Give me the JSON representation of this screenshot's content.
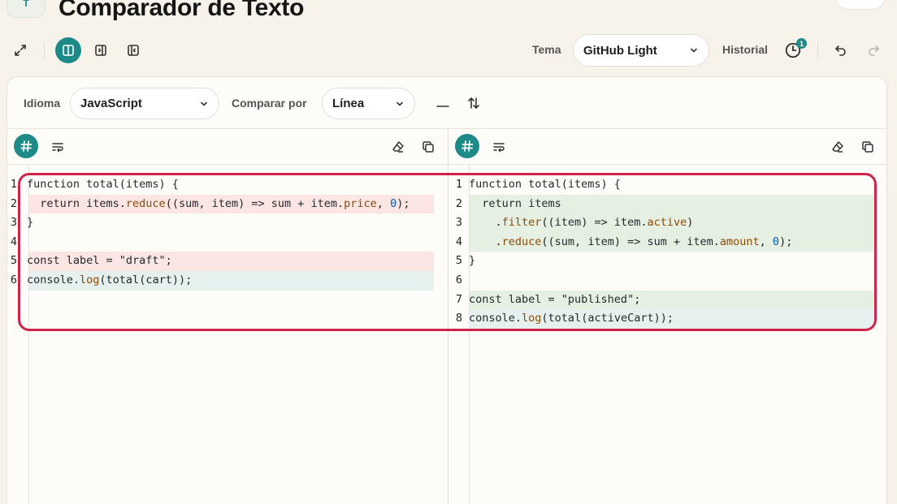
{
  "header": {
    "logo_text": "T",
    "title": "Comparador de Texto"
  },
  "toolbar": {
    "theme_label": "Tema",
    "theme_value": "GitHub Light",
    "history_label": "Historial",
    "history_count": "1",
    "icons": [
      "expand-icon",
      "split-view-icon",
      "left-panel-icon",
      "right-panel-icon",
      "history-icon",
      "undo-icon",
      "redo-icon"
    ]
  },
  "settings": {
    "language_label": "Idioma",
    "language_value": "JavaScript",
    "compare_label": "Comparar por",
    "compare_value": "Línea"
  },
  "colors": {
    "accent": "#1d8a87",
    "highlight": "#d0224a",
    "deleted_bg": "#fbe6e4",
    "added_bg": "#e5f0e2",
    "context_bg": "#e6f0ee"
  },
  "left_pane": {
    "lines": [
      {
        "n": "1",
        "state": "none",
        "parts": [
          {
            "t": "function total(items) {"
          }
        ]
      },
      {
        "n": "2",
        "state": "del",
        "parts": [
          {
            "t": "  return items."
          },
          {
            "t": "reduce",
            "c": "fn"
          },
          {
            "t": "((sum, item) => sum + item."
          },
          {
            "t": "price",
            "c": "fn"
          },
          {
            "t": ", "
          },
          {
            "t": "0",
            "c": "num"
          },
          {
            "t": ");"
          }
        ]
      },
      {
        "n": "3",
        "state": "none",
        "parts": [
          {
            "t": "}"
          }
        ]
      },
      {
        "n": "4",
        "state": "none",
        "parts": [
          {
            "t": ""
          }
        ]
      },
      {
        "n": "5",
        "state": "del",
        "parts": [
          {
            "t": "const label = \"draft\";"
          }
        ]
      },
      {
        "n": "6",
        "state": "ctx",
        "parts": [
          {
            "t": "console."
          },
          {
            "t": "log",
            "c": "fn"
          },
          {
            "t": "(total(cart));"
          }
        ]
      }
    ]
  },
  "right_pane": {
    "lines": [
      {
        "n": "1",
        "state": "none",
        "parts": [
          {
            "t": "function total(items) {"
          }
        ]
      },
      {
        "n": "2",
        "state": "add",
        "parts": [
          {
            "t": "  return items"
          }
        ]
      },
      {
        "n": "3",
        "state": "add",
        "parts": [
          {
            "t": "    ."
          },
          {
            "t": "filter",
            "c": "fn"
          },
          {
            "t": "((item) => item."
          },
          {
            "t": "active",
            "c": "fn"
          },
          {
            "t": ")"
          }
        ]
      },
      {
        "n": "4",
        "state": "add",
        "parts": [
          {
            "t": "    ."
          },
          {
            "t": "reduce",
            "c": "fn"
          },
          {
            "t": "((sum, item) => sum + item."
          },
          {
            "t": "amount",
            "c": "fn"
          },
          {
            "t": ", "
          },
          {
            "t": "0",
            "c": "num"
          },
          {
            "t": ");"
          }
        ]
      },
      {
        "n": "5",
        "state": "none",
        "parts": [
          {
            "t": "}"
          }
        ]
      },
      {
        "n": "6",
        "state": "none",
        "parts": [
          {
            "t": ""
          }
        ]
      },
      {
        "n": "7",
        "state": "add",
        "parts": [
          {
            "t": "const label = \"published\";"
          }
        ]
      },
      {
        "n": "8",
        "state": "ctx",
        "parts": [
          {
            "t": "console."
          },
          {
            "t": "log",
            "c": "fn"
          },
          {
            "t": "(total(activeCart));"
          }
        ]
      }
    ]
  }
}
